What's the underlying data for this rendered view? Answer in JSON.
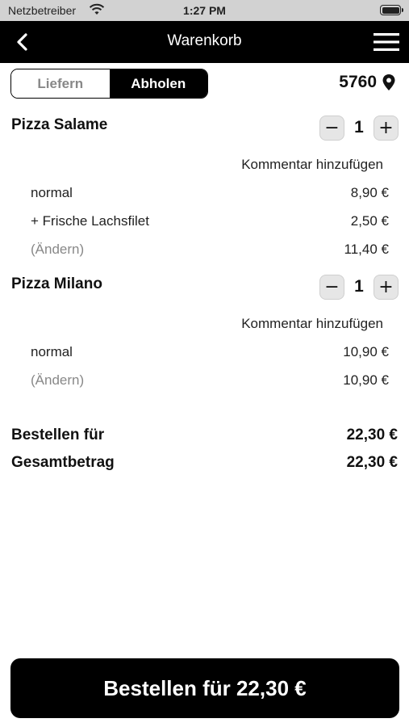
{
  "status_bar": {
    "carrier": "Netzbetreiber",
    "time": "1:27 PM"
  },
  "nav": {
    "title": "Warenkorb"
  },
  "mode_toggle": {
    "options": [
      "Liefern",
      "Abholen"
    ],
    "selected": "Abholen"
  },
  "location": {
    "zip": "5760"
  },
  "cart": {
    "items": [
      {
        "name": "Pizza Salame",
        "quantity": "1",
        "comment_label": "Kommentar hinzufügen",
        "lines": [
          {
            "label": "normal",
            "price": "8,90 €"
          },
          {
            "label": "+ Frische Lachsfilet",
            "price": "2,50 €"
          }
        ],
        "change_label": "(Ändern)",
        "subtotal": "11,40 €"
      },
      {
        "name": "Pizza Milano",
        "quantity": "1",
        "comment_label": "Kommentar hinzufügen",
        "lines": [
          {
            "label": "normal",
            "price": "10,90 €"
          }
        ],
        "change_label": "(Ändern)",
        "subtotal": "10,90 €"
      }
    ]
  },
  "totals": {
    "order_for_label": "Bestellen für",
    "order_for_value": "22,30 €",
    "total_label": "Gesamtbetrag",
    "total_value": "22,30 €"
  },
  "order_button": {
    "label": "Bestellen für 22,30 €"
  },
  "icons": {
    "minus": "−",
    "plus": "+"
  }
}
